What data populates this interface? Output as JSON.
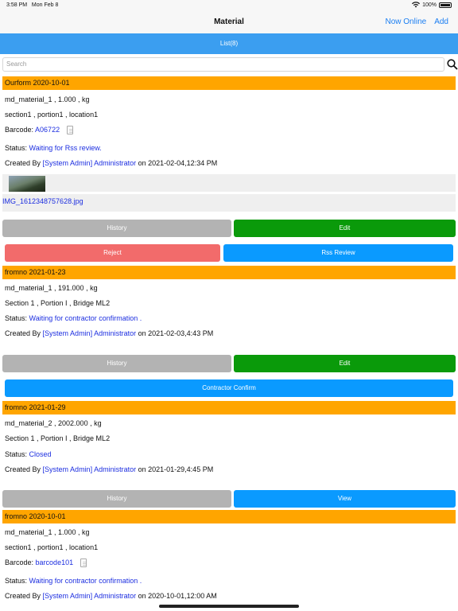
{
  "status_bar": {
    "time": "3:58 PM",
    "date": "Mon Feb 8",
    "battery": "100%"
  },
  "nav": {
    "title": "Material",
    "now_online": "Now Online",
    "add": "Add"
  },
  "list_header": "List(8)",
  "search": {
    "placeholder": "Search"
  },
  "labels": {
    "barcode": "Barcode:",
    "status": "Status:",
    "created_by": "Created By",
    "on": "on"
  },
  "buttons": {
    "history": "History",
    "edit": "Edit",
    "reject": "Reject",
    "rss_review": "Rss Review",
    "contractor_confirm": "Contractor Confirm",
    "view": "View"
  },
  "records": [
    {
      "header": "Ourform  2020-10-01",
      "material": "md_material_1 , 1.000 , kg",
      "location": "section1 , portion1 , location1",
      "barcode": "A06722",
      "status": "Waiting for Rss review.",
      "creator": "[System Admin] Administrator",
      "created_at": "2021-02-04,12:34 PM",
      "attachment": "IMG_1612348757628.jpg"
    },
    {
      "header": "fromno  2021-01-23",
      "material": "md_material_1 , 191.000 , kg",
      "location": "Section 1 , Portion I , Bridge ML2",
      "status": "Waiting for contractor confirmation .",
      "creator": "[System Admin] Administrator",
      "created_at": "2021-02-03,4:43 PM"
    },
    {
      "header": "fromno  2021-01-29",
      "material": "md_material_2 , 2002.000 , kg",
      "location": "Section 1 , Portion I , Bridge ML2",
      "status": "Closed",
      "creator": "[System Admin] Administrator",
      "created_at": "2021-01-29,4:45 PM"
    },
    {
      "header": "fromno  2020-10-01",
      "material": "md_material_1 , 1.000 , kg",
      "location": "section1 , portion1 , location1",
      "barcode": "barcode101",
      "status": "Waiting for contractor confirmation .",
      "creator": "[System Admin] Administrator",
      "created_at": "2020-10-01,12:00 AM"
    }
  ],
  "colors": {
    "header_orange": "#ffa500",
    "list_blue": "#3b9ef0",
    "edit_green": "#0a9a0a",
    "reject_red": "#f26b6b",
    "action_blue": "#0a9aff",
    "history_gray": "#b3b3b3",
    "link_blue": "#1c2ee0"
  }
}
